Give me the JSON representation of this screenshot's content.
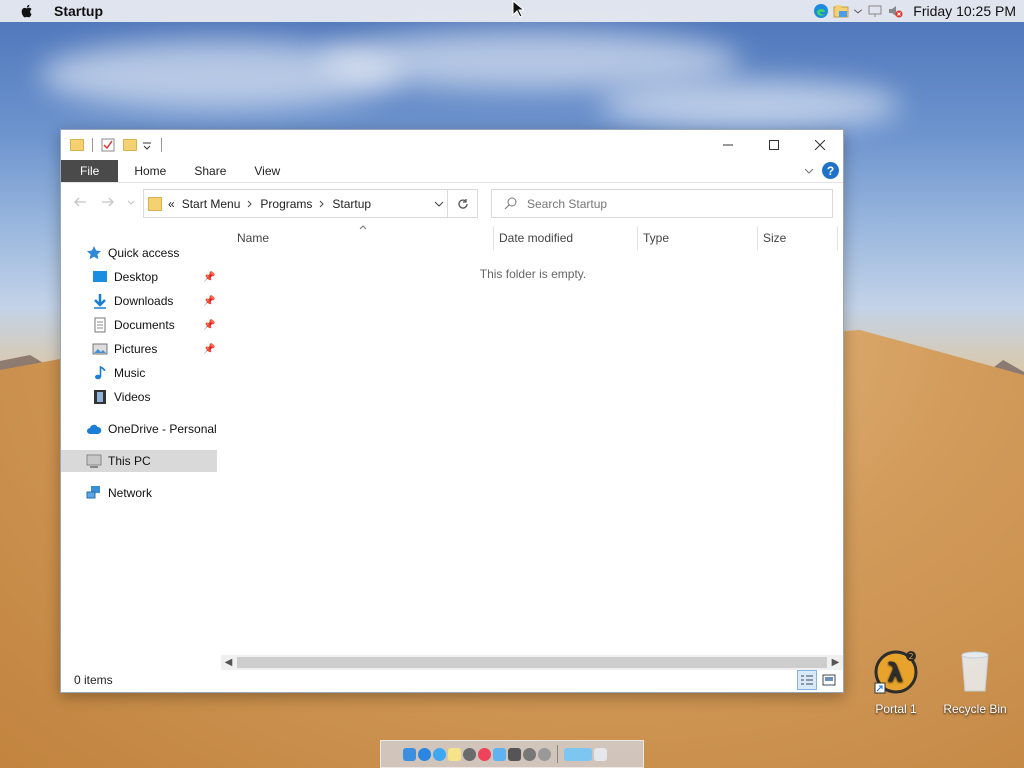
{
  "menubar": {
    "app_title": "Startup",
    "clock": "Friday 10:25 PM"
  },
  "window": {
    "ribbon_tabs": [
      "File",
      "Home",
      "Share",
      "View"
    ],
    "help_label": "?",
    "breadcrumb": {
      "overflow": "«",
      "parts": [
        "Start Menu",
        "Programs",
        "Startup"
      ]
    },
    "search_placeholder": "Search Startup",
    "nav": {
      "quick_access": "Quick access",
      "desktop": "Desktop",
      "downloads": "Downloads",
      "documents": "Documents",
      "pictures": "Pictures",
      "music": "Music",
      "videos": "Videos",
      "onedrive": "OneDrive - Personal",
      "this_pc": "This PC",
      "network": "Network"
    },
    "columns": [
      "Name",
      "Date modified",
      "Type",
      "Size"
    ],
    "empty_message": "This folder is empty.",
    "status": "0 items"
  },
  "desktop_icons": {
    "portal": "Portal 1",
    "recycle_bin": "Recycle Bin"
  },
  "colors": {
    "accent": "#1e73c9",
    "file_tab": "#4a4a4a",
    "folder": "#f5d171"
  }
}
